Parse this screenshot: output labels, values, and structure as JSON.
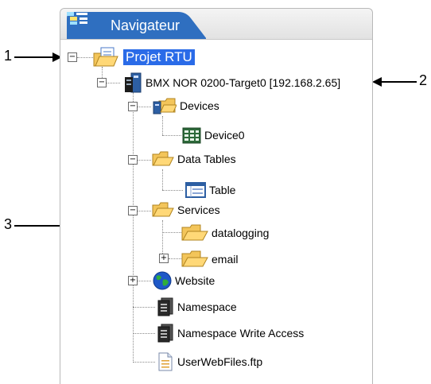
{
  "panel": {
    "tab_title": "Navigateur"
  },
  "tree": {
    "root": "Projet RTU",
    "target": "BMX NOR 0200-Target0 [192.168.2.65]",
    "devices": "Devices",
    "device0": "Device0",
    "data_tables": "Data Tables",
    "table": "Table",
    "services": "Services",
    "datalogging": "datalogging",
    "email": "email",
    "website": "Website",
    "namespace": "Namespace",
    "namespace_write": "Namespace Write Access",
    "userwebfiles": "UserWebFiles.ftp"
  },
  "toggles": {
    "collapse": "−",
    "expand": "+"
  },
  "callouts": {
    "c1": "1",
    "c2": "2",
    "c3": "3"
  },
  "icons": [
    "navigator-icon",
    "project-folder-icon",
    "target-device-icon",
    "devices-folder-icon",
    "device-grid-icon",
    "folder-icon",
    "table-icon",
    "globe-icon",
    "namespace-icon",
    "file-icon"
  ],
  "colors": {
    "tab_blue": "#2f6fc0",
    "selection": "#2a6be8"
  }
}
